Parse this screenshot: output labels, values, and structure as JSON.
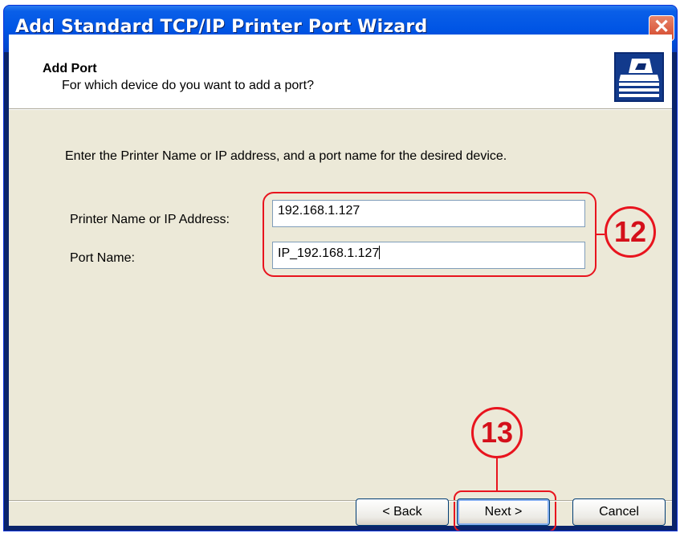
{
  "window": {
    "title": "Add Standard TCP/IP Printer Port Wizard",
    "close_glyph": "✕"
  },
  "header": {
    "title": "Add Port",
    "subtitle": "For which device do you want to add a port?",
    "icon": "printer-icon"
  },
  "body": {
    "instruction": "Enter the Printer Name or IP address, and a port name for the desired device.",
    "fields": [
      {
        "label": "Printer Name or IP Address:",
        "value": "192.168.1.127"
      },
      {
        "label": "Port Name:",
        "value": "IP_192.168.1.127"
      }
    ]
  },
  "annotations": {
    "step_fields": "12",
    "step_next": "13",
    "color": "#e8141e"
  },
  "buttons": {
    "back": "< Back",
    "next": "Next >",
    "cancel": "Cancel"
  }
}
